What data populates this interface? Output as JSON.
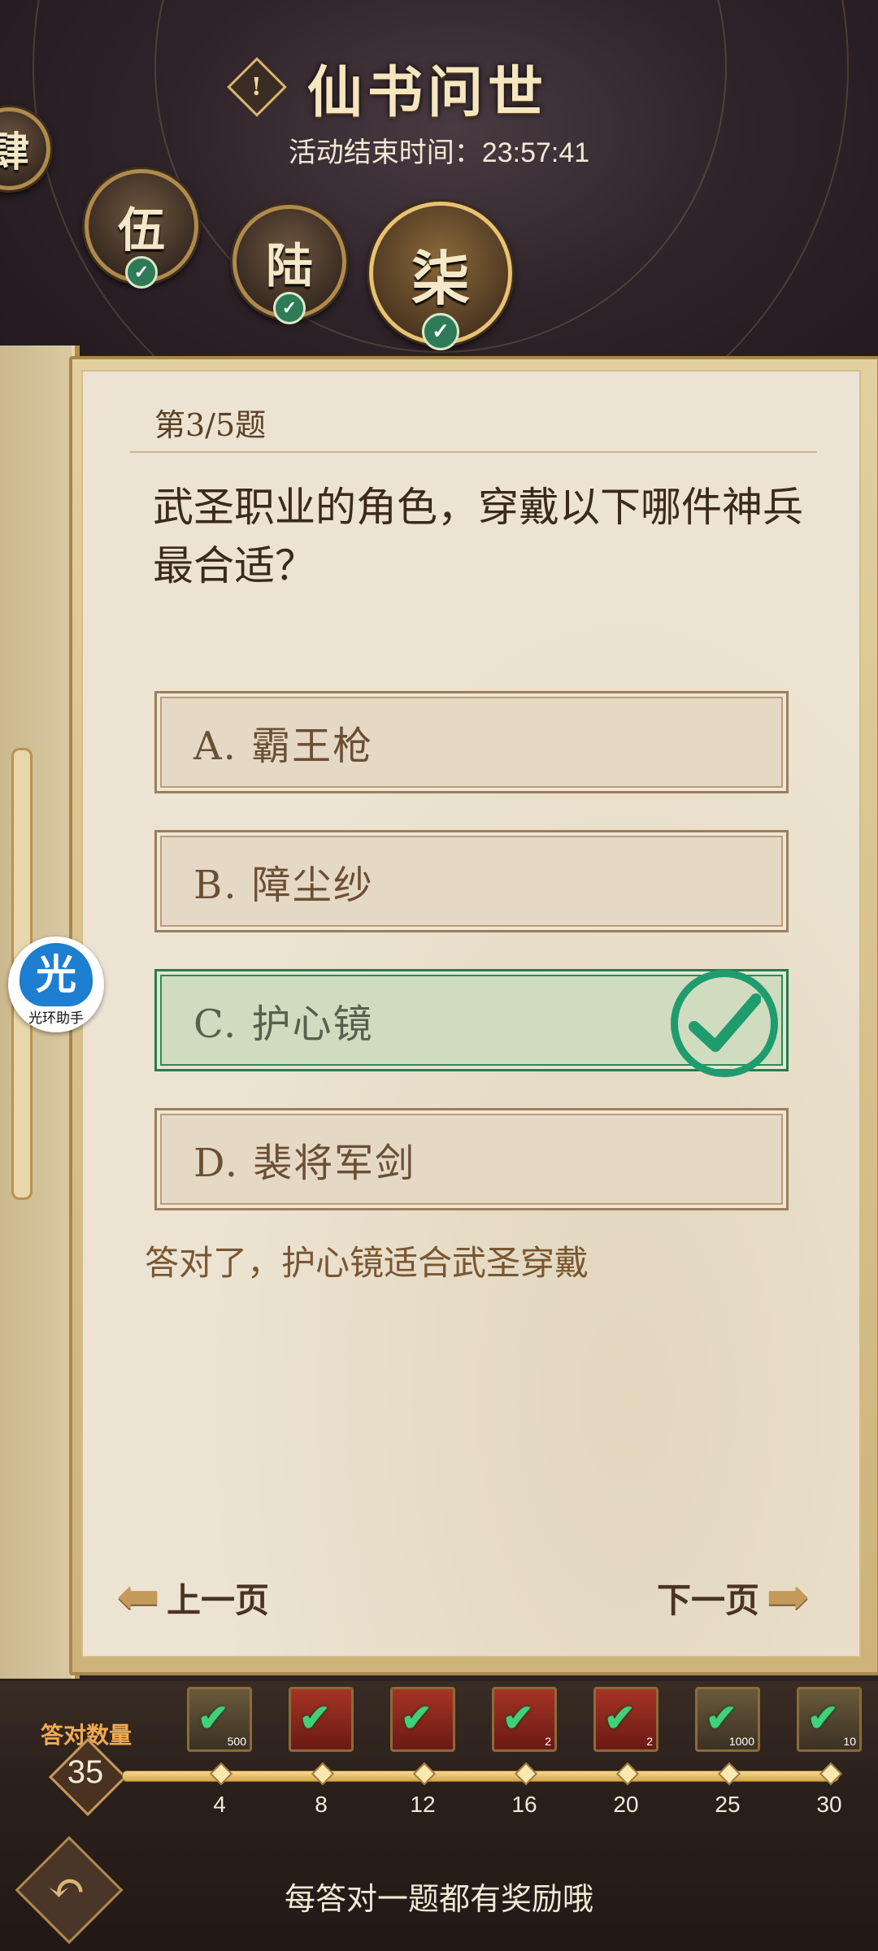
{
  "header": {
    "info_icon": "!",
    "title": "仙书问世",
    "end_time": "活动结束时间：23:57:41"
  },
  "chapters": [
    {
      "label": "肆",
      "completed": true
    },
    {
      "label": "伍",
      "completed": true
    },
    {
      "label": "陆",
      "completed": true
    },
    {
      "label": "柒",
      "completed": true,
      "current": true
    }
  ],
  "helper": {
    "glyph": "光",
    "label": "光环助手"
  },
  "quiz": {
    "number": "第3/5题",
    "question": "武圣职业的角色，穿戴以下哪件神兵最合适？",
    "options": [
      {
        "text": "A. 霸王枪"
      },
      {
        "text": "B. 障尘纱"
      },
      {
        "text": "C. 护心镜",
        "state": "correct"
      },
      {
        "text": "D. 裴将军剑"
      }
    ],
    "feedback": "答对了，护心镜适合武圣穿戴"
  },
  "nav": {
    "prev_label": "上一页",
    "next_label": "下一页"
  },
  "progress": {
    "count_label": "答对数量",
    "count_value": "35",
    "milestones": [
      {
        "tick": "4",
        "reward_count": "500",
        "reward_type": "gold",
        "claimed": true
      },
      {
        "tick": "8",
        "reward_count": "",
        "reward_type": "chest",
        "claimed": true
      },
      {
        "tick": "12",
        "reward_count": "",
        "reward_type": "chest",
        "claimed": true
      },
      {
        "tick": "16",
        "reward_count": "2",
        "reward_type": "chest",
        "claimed": true
      },
      {
        "tick": "20",
        "reward_count": "2",
        "reward_type": "chest",
        "claimed": true
      },
      {
        "tick": "25",
        "reward_count": "1000",
        "reward_type": "gold",
        "claimed": true
      },
      {
        "tick": "30",
        "reward_count": "10",
        "reward_type": "gear",
        "claimed": true
      }
    ]
  },
  "footer": {
    "tip": "每答对一题都有奖励哦"
  },
  "colors": {
    "correct": "#1f9c6e",
    "accent": "#c49a5a"
  }
}
